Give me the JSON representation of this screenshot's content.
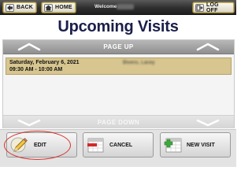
{
  "topbar": {
    "back_label": "BACK",
    "home_label": "HOME",
    "welcome_label": "Welcome",
    "logoff_label": "LOG OFF"
  },
  "page_title": "Upcoming Visits",
  "pager": {
    "up_label": "PAGE UP",
    "down_label": "PAGE DOWN"
  },
  "visits": [
    {
      "date": "Saturday, February 6, 2021",
      "time": "09:30 AM - 10:00 AM",
      "client": "Bivens, Lacey"
    }
  ],
  "actions": {
    "edit_label": "EDIT",
    "cancel_label": "CANCEL",
    "new_visit_label": "NEW VISIT"
  },
  "colors": {
    "title": "#1a1f4a",
    "selected_row": "#d8c690",
    "highlight_ring": "#d6332e"
  }
}
